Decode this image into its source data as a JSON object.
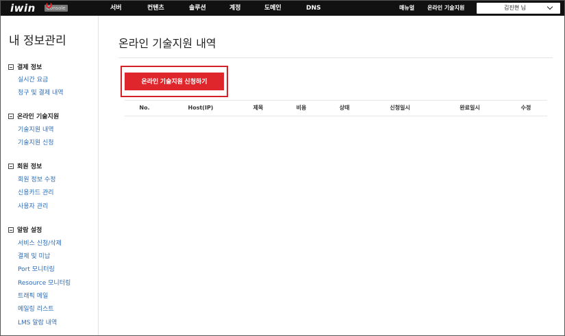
{
  "header": {
    "logo": "iwin",
    "logo_badge": "Console",
    "nav": [
      "서버",
      "컨텐츠",
      "솔루션",
      "계정",
      "도메인",
      "DNS"
    ],
    "links": [
      "매뉴얼",
      "온라인 기술지원"
    ],
    "user": "김진현 님"
  },
  "sidebar": {
    "title": "내 정보관리",
    "sections": [
      {
        "label": "결제 정보",
        "items": [
          "실시간 요금",
          "청구 및 결제 내역"
        ]
      },
      {
        "label": "온라인 기술지원",
        "items": [
          "기술지원 내역",
          "기술지원 신청"
        ]
      },
      {
        "label": "회원 정보",
        "items": [
          "회원 정보 수정",
          "신용카드 관리",
          "사용자 관리"
        ]
      },
      {
        "label": "알람 설정",
        "items": [
          "서비스 신청/삭제",
          "결제 및 미납",
          "Port 모니터링",
          "Resource 모니터링",
          "트래픽 메일",
          "메일링 리스트",
          "LMS 알람 내역"
        ]
      }
    ]
  },
  "main": {
    "title": "온라인 기술지원 내역",
    "apply_button": "온라인 기술지원 신청하기",
    "columns": [
      "No.",
      "Host(IP)",
      "제목",
      "비용",
      "상태",
      "신청일시",
      "완료일시",
      "수정"
    ]
  }
}
